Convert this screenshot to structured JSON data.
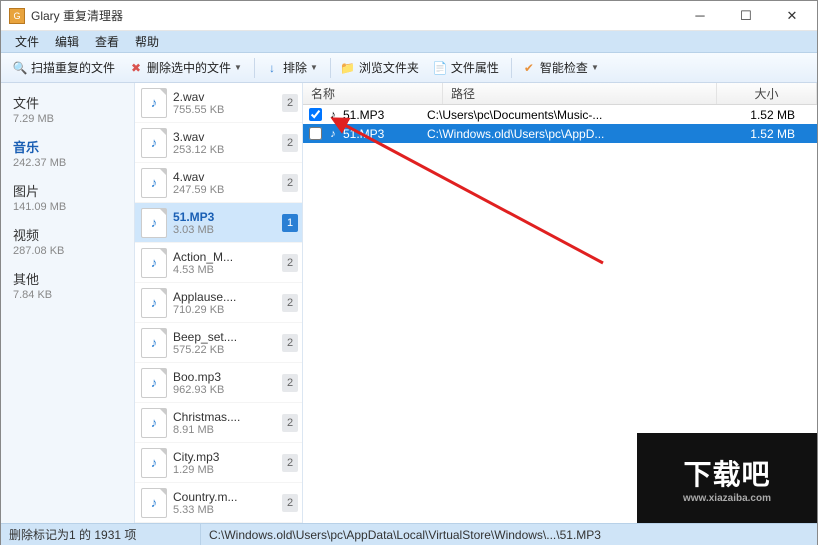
{
  "window": {
    "title": "Glary 重复清理器"
  },
  "menu": {
    "file": "文件",
    "edit": "编辑",
    "view": "查看",
    "help": "帮助"
  },
  "toolbar": {
    "scan": "扫描重复的文件",
    "delete": "删除选中的文件",
    "exclude": "排除",
    "browse": "浏览文件夹",
    "props": "文件属性",
    "smart": "智能检查"
  },
  "categories": [
    {
      "name": "文件",
      "size": "7.29 MB"
    },
    {
      "name": "音乐",
      "size": "242.37 MB"
    },
    {
      "name": "图片",
      "size": "141.09 MB"
    },
    {
      "name": "视频",
      "size": "287.08 KB"
    },
    {
      "name": "其他",
      "size": "7.84 KB"
    }
  ],
  "files": [
    {
      "name": "2.wav",
      "size": "755.55 KB",
      "badge": "2"
    },
    {
      "name": "3.wav",
      "size": "253.12 KB",
      "badge": "2"
    },
    {
      "name": "4.wav",
      "size": "247.59 KB",
      "badge": "2"
    },
    {
      "name": "51.MP3",
      "size": "3.03 MB",
      "badge": "1"
    },
    {
      "name": "Action_M...",
      "size": "4.53 MB",
      "badge": "2"
    },
    {
      "name": "Applause....",
      "size": "710.29 KB",
      "badge": "2"
    },
    {
      "name": "Beep_set....",
      "size": "575.22 KB",
      "badge": "2"
    },
    {
      "name": "Boo.mp3",
      "size": "962.93 KB",
      "badge": "2"
    },
    {
      "name": "Christmas....",
      "size": "8.91 MB",
      "badge": "2"
    },
    {
      "name": "City.mp3",
      "size": "1.29 MB",
      "badge": "2"
    },
    {
      "name": "Country.m...",
      "size": "5.33 MB",
      "badge": "2"
    }
  ],
  "detail": {
    "col_name": "名称",
    "col_path": "路径",
    "col_size": "大小",
    "rows": [
      {
        "checked": true,
        "name": "51.MP3",
        "path": "C:\\Users\\pc\\Documents\\Music-...",
        "size": "1.52 MB"
      },
      {
        "checked": false,
        "name": "51.MP3",
        "path": "C:\\Windows.old\\Users\\pc\\AppD...",
        "size": "1.52 MB"
      }
    ]
  },
  "status": {
    "left": "删除标记为1 的 1931 项",
    "right": "C:\\Windows.old\\Users\\pc\\AppData\\Local\\VirtualStore\\Windows\\...\\51.MP3"
  },
  "watermark": {
    "big": "下载吧",
    "small": "www.xiazaiba.com"
  }
}
